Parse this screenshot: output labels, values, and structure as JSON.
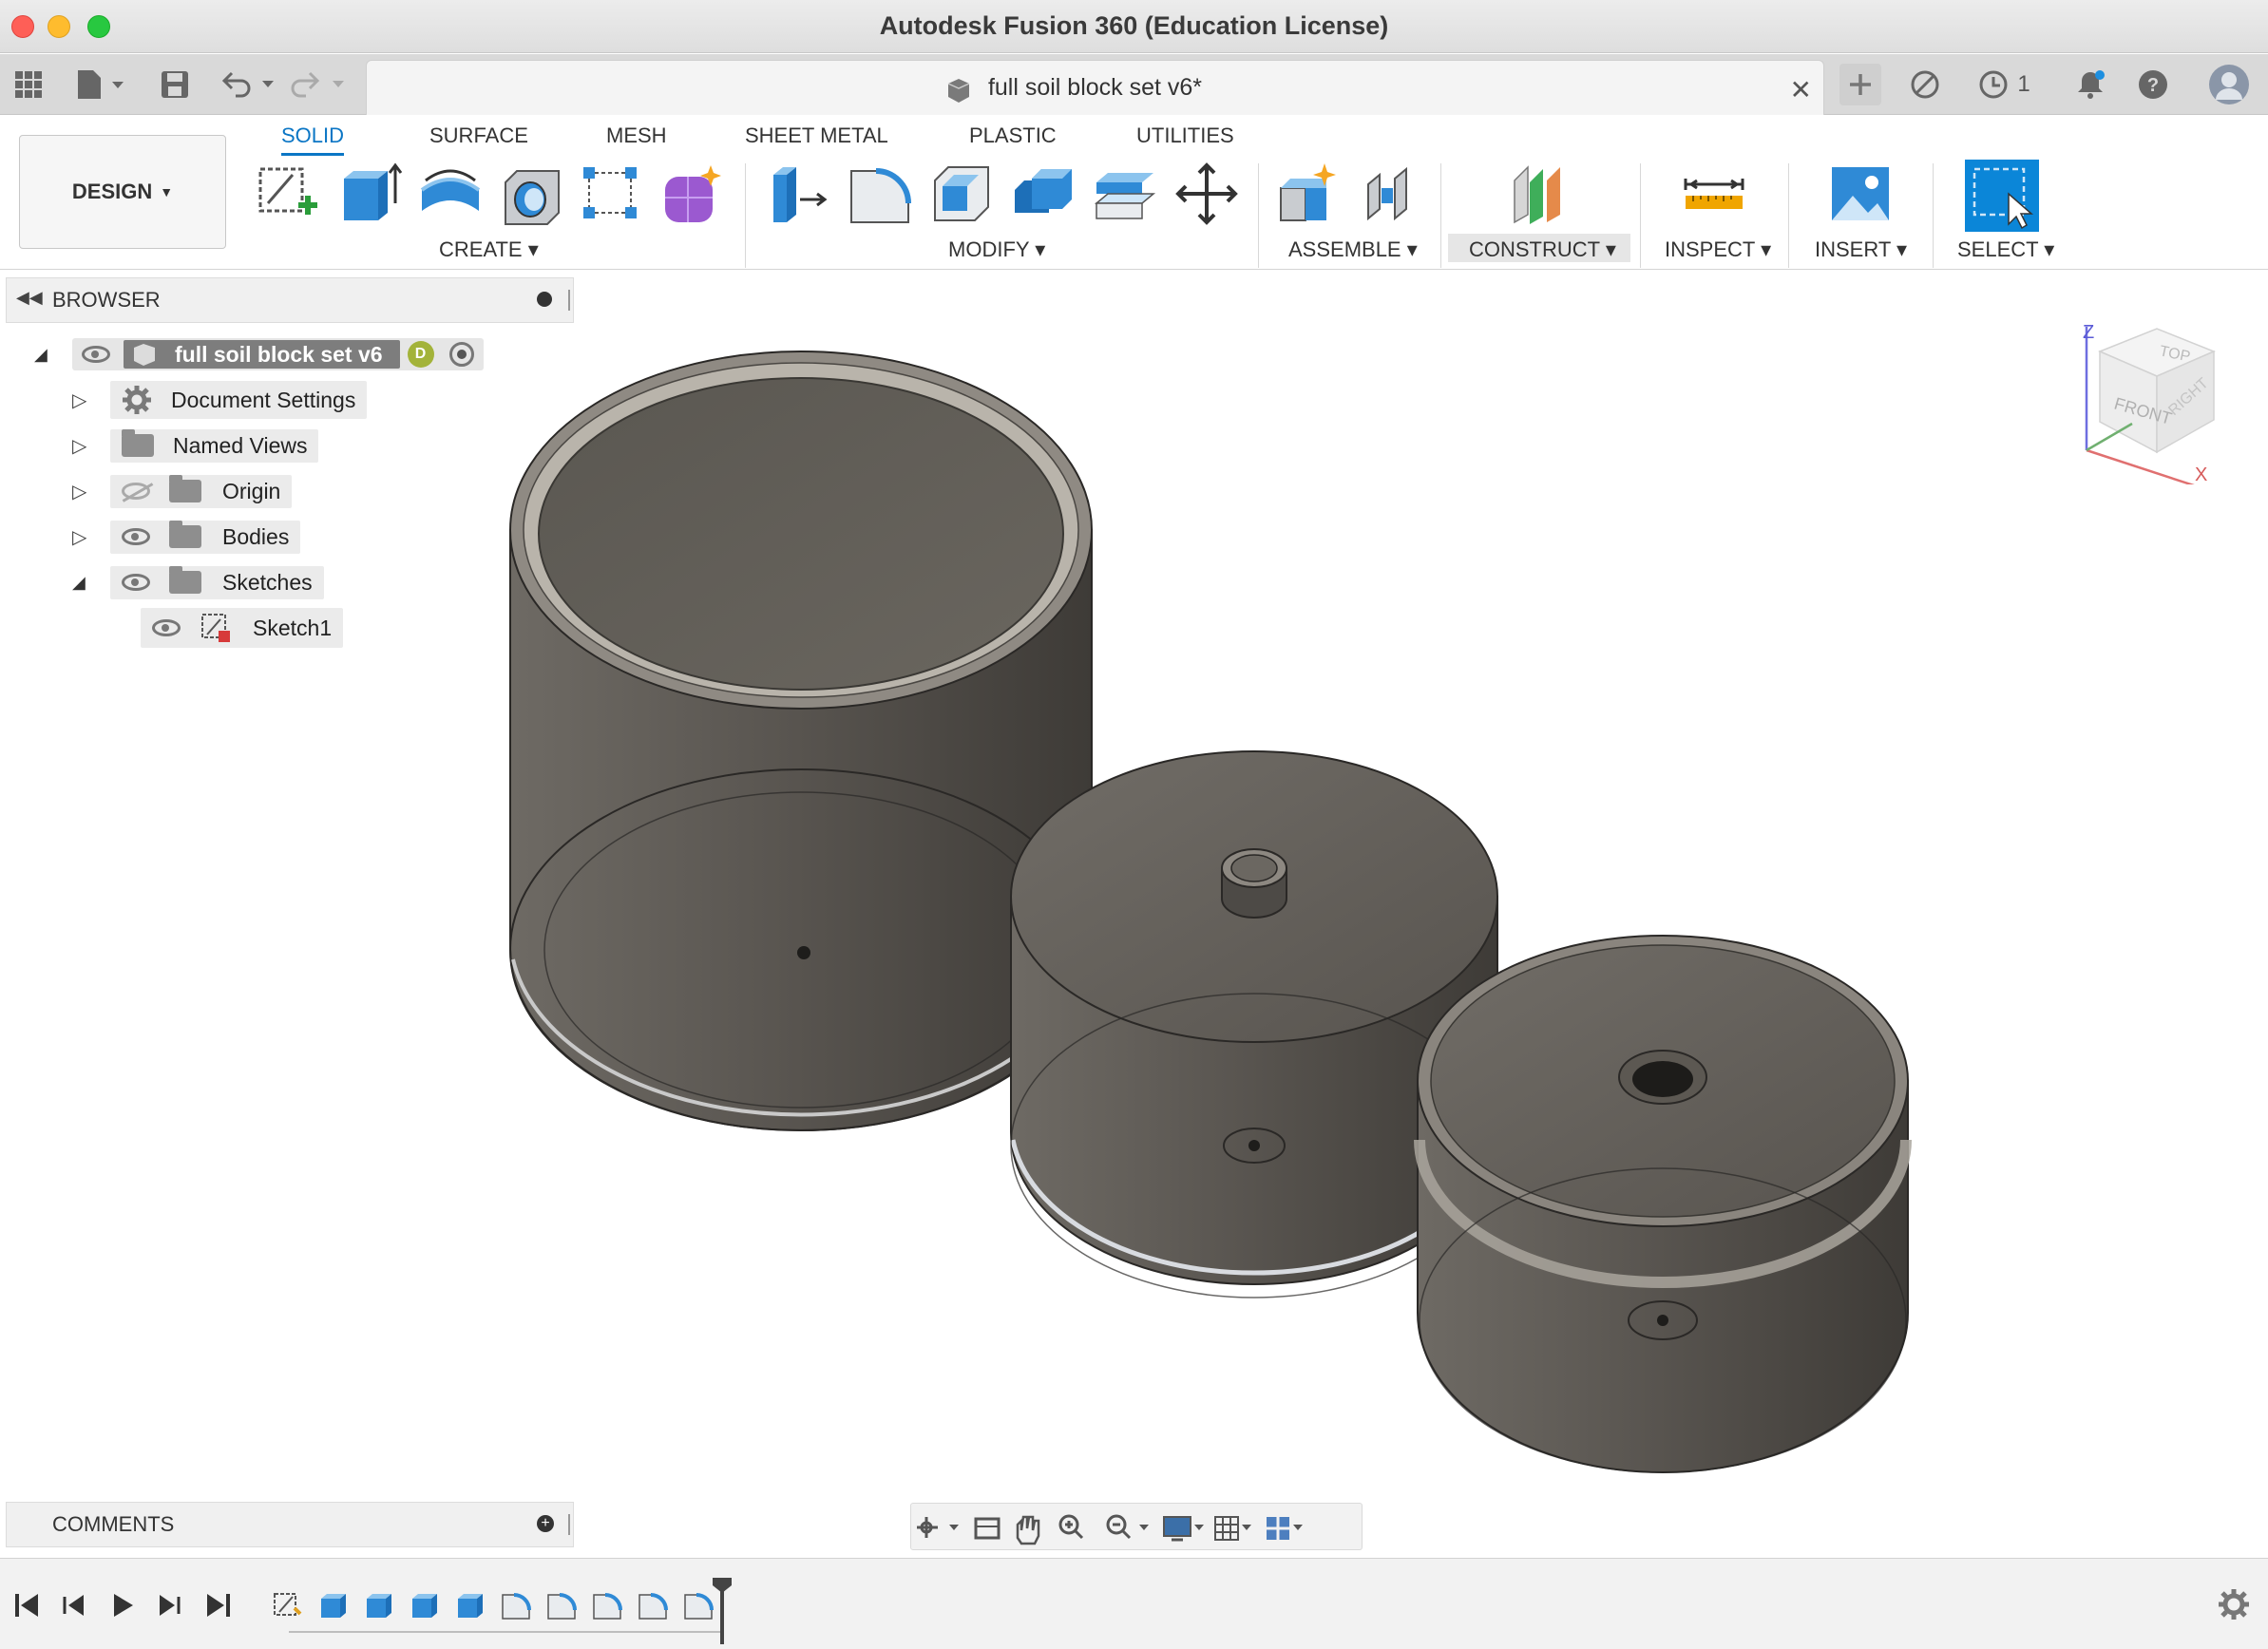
{
  "window": {
    "title": "Autodesk Fusion 360 (Education License)"
  },
  "tabbar": {
    "doc_title": "full soil block set v6*",
    "jobs_count": "1"
  },
  "workspace": {
    "label": "DESIGN"
  },
  "ribbon": {
    "tabs": [
      "SOLID",
      "SURFACE",
      "MESH",
      "SHEET METAL",
      "PLASTIC",
      "UTILITIES"
    ],
    "groups": {
      "create": "CREATE",
      "modify": "MODIFY",
      "assemble": "ASSEMBLE",
      "construct": "CONSTRUCT",
      "inspect": "INSPECT",
      "insert": "INSERT",
      "select": "SELECT"
    }
  },
  "browser": {
    "title": "BROWSER",
    "root": "full soil block set v6",
    "items": [
      "Document Settings",
      "Named Views",
      "Origin",
      "Bodies",
      "Sketches",
      "Sketch1"
    ]
  },
  "viewcube": {
    "top": "TOP",
    "front": "FRONT",
    "right": "RIGHT",
    "z": "Z",
    "x": "X"
  },
  "comments": {
    "title": "COMMENTS"
  }
}
